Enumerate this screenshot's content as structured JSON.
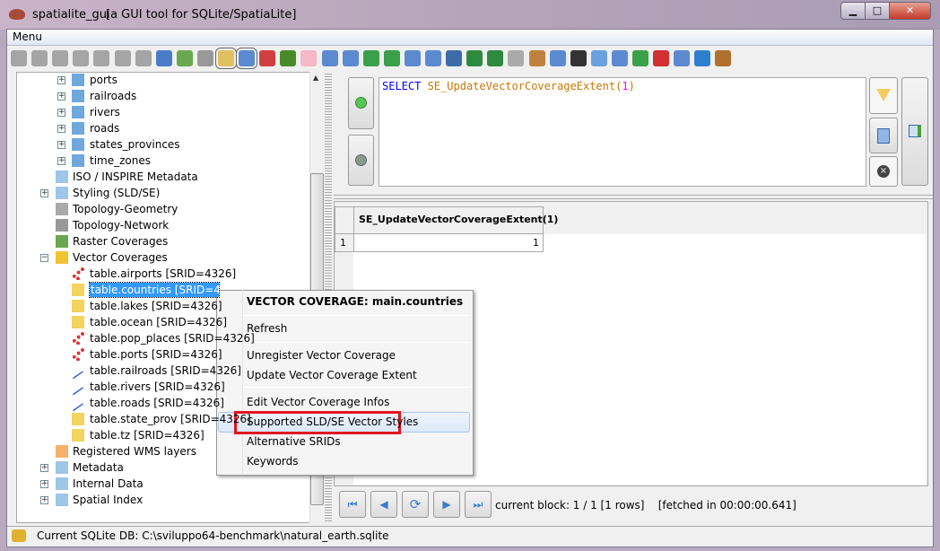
{
  "window": {
    "title": "spatialite_gui",
    "subtitle": "[a GUI tool for SQLite/SpatiaLite]",
    "minimize": "▁",
    "maximize": "□",
    "close": "✕"
  },
  "menu": {
    "label": "Menu"
  },
  "toolbar": {
    "icons": [
      "connect-icon",
      "disconnect-icon",
      "create-db-icon",
      "memory-db-icon",
      "memory-db-save-icon",
      "memory-db-new-icon",
      "memory-db-clone-icon",
      "attach-icon",
      "vacuum-icon",
      "sql-script-icon",
      "load-shp-icon",
      "load-txt-icon",
      "charts-icon",
      "check-geometry-icon",
      "sanitize-icon",
      "load-dbf-icon",
      "edit-icon",
      "virtual-shp-icon",
      "virtual-dbf-icon",
      "load-xl-icon",
      "virtual-xl-icon",
      "export-icon",
      "export-xl-icon",
      "virtual-xl-link-icon",
      "link-icon",
      "raster-icon",
      "copy-icon",
      "text-icon",
      "wms-icon",
      "network-icon",
      "globe-icon",
      "font-icon",
      "help-icon",
      "about-icon",
      "exit-icon"
    ]
  },
  "tree": {
    "items": [
      {
        "label": "ports",
        "level": 2,
        "plus": "+",
        "icon": "table-geometry-icon"
      },
      {
        "label": "railroads",
        "level": 2,
        "plus": "+",
        "icon": "table-geometry-icon"
      },
      {
        "label": "rivers",
        "level": 2,
        "plus": "+",
        "icon": "table-geometry-icon"
      },
      {
        "label": "roads",
        "level": 2,
        "plus": "+",
        "icon": "table-geometry-icon"
      },
      {
        "label": "states_provinces",
        "level": 2,
        "plus": "+",
        "icon": "table-geometry-icon"
      },
      {
        "label": "time_zones",
        "level": 2,
        "plus": "+",
        "icon": "table-geometry-icon"
      },
      {
        "label": "ISO / INSPIRE Metadata",
        "level": 1,
        "plus": "",
        "icon": "metadata-icon"
      },
      {
        "label": "Styling (SLD/SE)",
        "level": 1,
        "plus": "+",
        "icon": "styling-icon"
      },
      {
        "label": "Topology-Geometry",
        "level": 1,
        "plus": "",
        "icon": "topology-icon"
      },
      {
        "label": "Topology-Network",
        "level": 1,
        "plus": "",
        "icon": "network-icon"
      },
      {
        "label": "Raster Coverages",
        "level": 1,
        "plus": "",
        "icon": "raster-icon"
      },
      {
        "label": "Vector Coverages",
        "level": 1,
        "plus": "−",
        "icon": "box-icon"
      },
      {
        "label": "table.airports [SRID=4326]",
        "level": 2,
        "plus": "",
        "icon": "points-icon"
      },
      {
        "label": "table.countries [SRID=4326]",
        "level": 2,
        "plus": "",
        "icon": "polygon-icon",
        "selected": true
      },
      {
        "label": "table.lakes [SRID=4326]",
        "level": 2,
        "plus": "",
        "icon": "polygon-icon"
      },
      {
        "label": "table.ocean [SRID=4326]",
        "level": 2,
        "plus": "",
        "icon": "polygon-icon"
      },
      {
        "label": "table.pop_places [SRID=4326]",
        "level": 2,
        "plus": "",
        "icon": "points-icon"
      },
      {
        "label": "table.ports [SRID=4326]",
        "level": 2,
        "plus": "",
        "icon": "points-icon"
      },
      {
        "label": "table.railroads [SRID=4326]",
        "level": 2,
        "plus": "",
        "icon": "line-icon"
      },
      {
        "label": "table.rivers [SRID=4326]",
        "level": 2,
        "plus": "",
        "icon": "line-icon"
      },
      {
        "label": "table.roads [SRID=4326]",
        "level": 2,
        "plus": "",
        "icon": "line-icon"
      },
      {
        "label": "table.state_prov [SRID=4326]",
        "level": 2,
        "plus": "",
        "icon": "polygon-icon"
      },
      {
        "label": "table.tz [SRID=4326]",
        "level": 2,
        "plus": "",
        "icon": "polygon-icon"
      },
      {
        "label": "Registered WMS layers",
        "level": 1,
        "plus": "",
        "icon": "wms-icon"
      },
      {
        "label": "Metadata",
        "level": 1,
        "plus": "+",
        "icon": "metadata-icon"
      },
      {
        "label": "Internal Data",
        "level": 1,
        "plus": "+",
        "icon": "metadata-icon"
      },
      {
        "label": "Spatial Index",
        "level": 1,
        "plus": "+",
        "icon": "metadata-icon"
      }
    ]
  },
  "sql": {
    "keyword": "SELECT",
    "function": "SE_UpdateVectorCoverageExtent",
    "open": "(",
    "arg": "1",
    "close": ")"
  },
  "results": {
    "columns": [
      "SE_UpdateVectorCoverageExtent(1)"
    ],
    "rows": [
      {
        "num": "1",
        "values": [
          "1"
        ]
      }
    ]
  },
  "nav": {
    "status": "current block: 1 / 1 [1 rows]",
    "fetched": "[fetched in 00:00:00.641]"
  },
  "statusbar": {
    "text": "Current SQLite DB: C:\\sviluppo64-benchmark\\natural_earth.sqlite"
  },
  "context_menu": {
    "header": "VECTOR COVERAGE: main.countries",
    "items": [
      "Refresh",
      "Unregister Vector Coverage",
      "Update Vector Coverage Extent",
      "Edit Vector Coverage Infos",
      "Supported SLD/SE Vector Styles",
      "Alternative SRIDs",
      "Keywords"
    ],
    "highlighted": "Supported SLD/SE Vector Styles"
  },
  "colors": {
    "selection": "#3399ff",
    "highlight_box": "#e0141e",
    "sql_keyword": "#0000ff",
    "sql_function": "#c87800",
    "sql_number": "#ff00ff"
  }
}
